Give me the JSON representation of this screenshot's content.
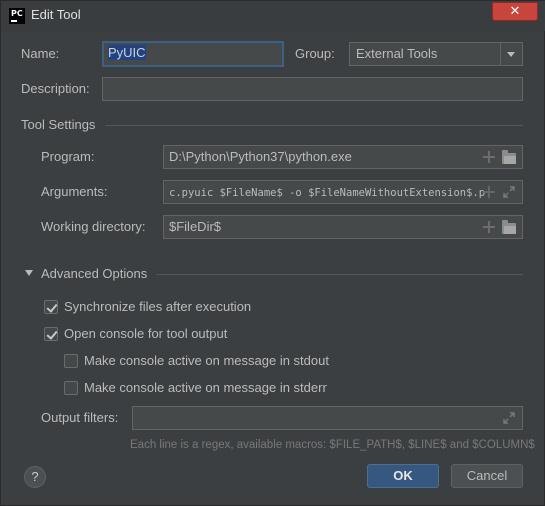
{
  "window": {
    "title": "Edit Tool",
    "app_icon_text": "PC",
    "close_glyph": "✕"
  },
  "form": {
    "name_label": "Name:",
    "name_value": "PyUIC",
    "group_label": "Group:",
    "group_value": "External Tools",
    "description_label": "Description:",
    "description_value": ""
  },
  "tool_settings": {
    "title": "Tool Settings",
    "program_label": "Program:",
    "program_value": "D:\\Python\\Python37\\python.exe",
    "arguments_label": "Arguments:",
    "arguments_value": "c.pyuic  $FileName$ -o $FileNameWithoutExtension$.p",
    "working_dir_label": "Working directory:",
    "working_dir_value": "$FileDir$"
  },
  "advanced": {
    "title": "Advanced Options",
    "sync_files_label": "Synchronize files after execution",
    "sync_files_checked": true,
    "open_console_label": "Open console for tool output",
    "open_console_checked": true,
    "console_stdout_label": "Make console active on message in stdout",
    "console_stdout_checked": false,
    "console_stderr_label": "Make console active on message in stderr",
    "console_stderr_checked": false,
    "output_filters_label": "Output filters:",
    "output_filters_value": "",
    "hint": "Each line is a regex, available macros: $FILE_PATH$, $LINE$ and $COLUMN$"
  },
  "buttons": {
    "help": "?",
    "ok": "OK",
    "cancel": "Cancel"
  },
  "colors": {
    "background": "#3c3f41",
    "field_bg": "#45494a",
    "accent": "#365880",
    "close": "#c7453c"
  }
}
